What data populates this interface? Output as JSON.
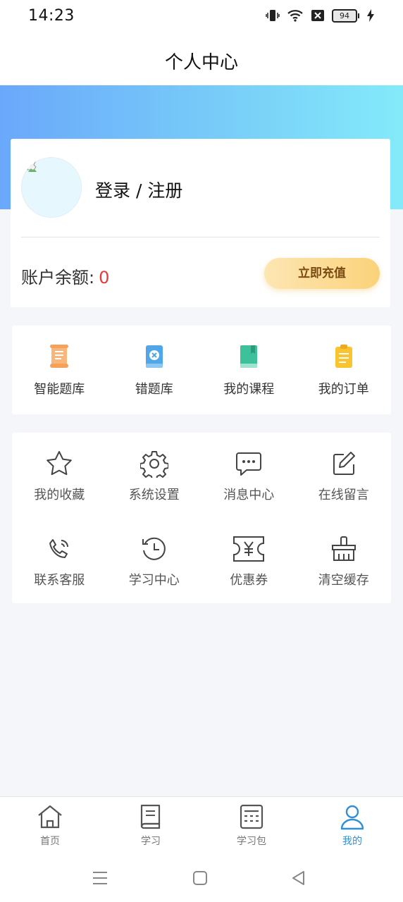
{
  "status_bar": {
    "time": "14:23",
    "battery": "94"
  },
  "header": {
    "title": "个人中心"
  },
  "profile": {
    "login_text": "登录 / 注册",
    "balance_label": "账户余额:",
    "balance_value": "0",
    "recharge_label": "立即充值"
  },
  "features": [
    {
      "label": "智能题库",
      "icon": "scroll-icon",
      "color": "#f6a15a"
    },
    {
      "label": "错题库",
      "icon": "wrong-book-icon",
      "color": "#4fa6e8"
    },
    {
      "label": "我的课程",
      "icon": "course-book-icon",
      "color": "#3cc19a"
    },
    {
      "label": "我的订单",
      "icon": "clipboard-icon",
      "color": "#f8c531"
    }
  ],
  "menu": [
    {
      "label": "我的收藏",
      "icon": "star-icon"
    },
    {
      "label": "系统设置",
      "icon": "gear-icon"
    },
    {
      "label": "消息中心",
      "icon": "chat-icon"
    },
    {
      "label": "在线留言",
      "icon": "edit-icon"
    },
    {
      "label": "联系客服",
      "icon": "phone-icon"
    },
    {
      "label": "学习中心",
      "icon": "history-icon"
    },
    {
      "label": "优惠券",
      "icon": "coupon-icon"
    },
    {
      "label": "清空缓存",
      "icon": "broom-icon"
    }
  ],
  "tabbar": [
    {
      "label": "首页",
      "icon": "home-icon"
    },
    {
      "label": "学习",
      "icon": "book-icon"
    },
    {
      "label": "学习包",
      "icon": "package-icon"
    },
    {
      "label": "我的",
      "icon": "user-icon",
      "active": true
    }
  ],
  "colors": {
    "accent": "#2f8fd8",
    "balance": "#e23c3c",
    "hero_start": "#6aa8fb",
    "hero_end": "#84eafa"
  }
}
